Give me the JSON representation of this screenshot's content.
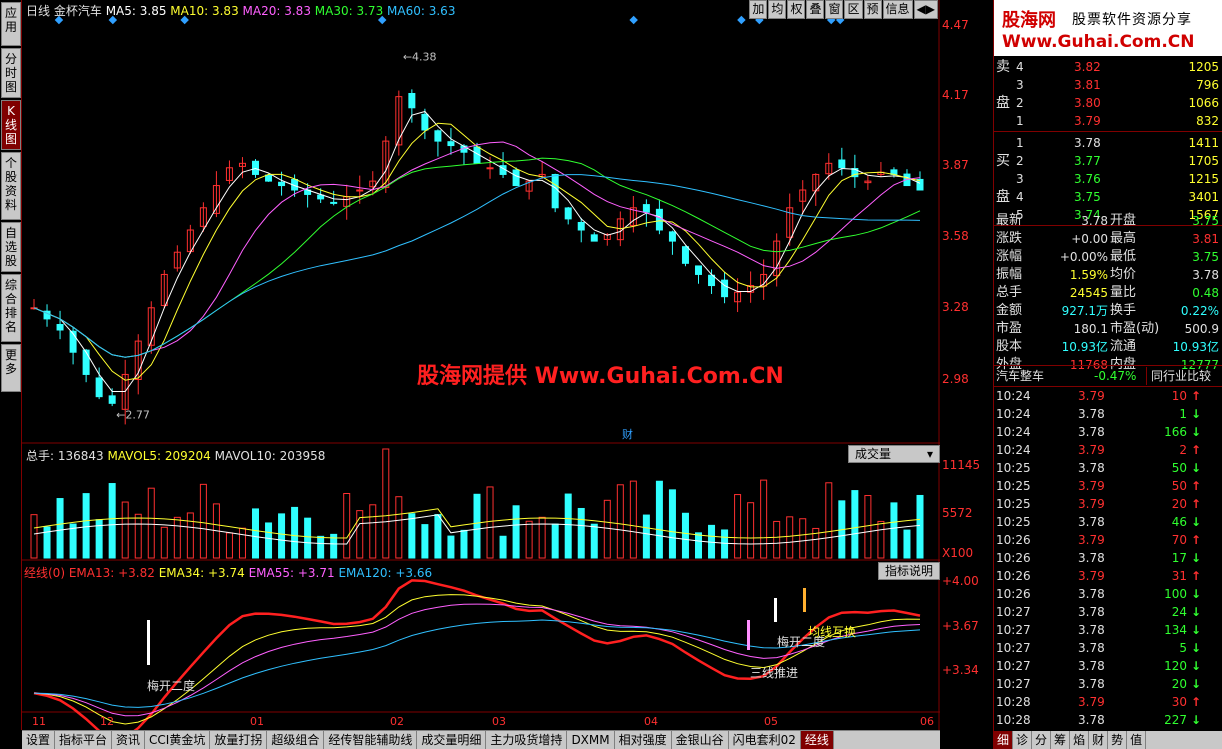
{
  "left_tabs": [
    {
      "label": "应用"
    },
    {
      "label": "分时图"
    },
    {
      "label": "K线图",
      "active": true
    },
    {
      "label": "个股资料"
    },
    {
      "label": "自选股"
    },
    {
      "label": "综合排名"
    },
    {
      "label": "更多"
    }
  ],
  "top_info": {
    "period": "日线",
    "stock_name": "金杯汽车",
    "ma5": "MA5: 3.85",
    "ma10": "MA10: 3.83",
    "ma20": "MA20: 3.83",
    "ma30": "MA30: 3.73",
    "ma60": "MA60: 3.63"
  },
  "top_buttons": [
    "加",
    "均",
    "权",
    "叠",
    "窗",
    "区",
    "预",
    "信息",
    "◀▶"
  ],
  "price_axis": [
    "4.47",
    "4.17",
    "3.87",
    "3.58",
    "3.28",
    "2.98"
  ],
  "price_annotations": {
    "high": "4.38",
    "low": "2.77",
    "cai_marker": "财"
  },
  "watermark": "股海网提供 Www.Guhai.Com.CN",
  "volume_panel": {
    "title": "总手: 136843",
    "mavol5": "MAVOL5: 209204",
    "mavol10": "MAVOL10: 203958",
    "combo": "成交量",
    "axis": [
      "11145",
      "5572",
      "X100"
    ]
  },
  "jingxian_panel": {
    "title": "经线(0)",
    "ema13": "EMA13: +3.82",
    "ema34": "EMA34: +3.74",
    "ema55": "EMA55: +3.71",
    "ema120": "EMA120: +3.66",
    "combo": "指标说明",
    "axis": [
      "+4.00",
      "+3.67",
      "+3.34"
    ],
    "annotations": [
      "梅开二度",
      "梅开二度",
      "三线推进",
      "均线互换"
    ]
  },
  "date_axis": [
    "11",
    "12",
    "01",
    "02",
    "03",
    "04",
    "05",
    "06"
  ],
  "bottom_tabs": [
    "设置",
    "指标平台",
    "资讯",
    "CCI黄金坑",
    "放量打拐",
    "超级组合",
    "经传智能辅助线",
    "成交量明细",
    "主力吸货增持",
    "DXMM",
    "相对强度",
    "金银山谷",
    "闪电套利02",
    "经线"
  ],
  "colors": {
    "up": "#ff3030",
    "down": "#30ffff",
    "ma5": "#ffffff",
    "ma10": "#ffff30",
    "ma20": "#ff60ff",
    "ma30": "#30ff30",
    "ma60": "#30c0ff"
  },
  "logo": {
    "brand": "股海网",
    "slogan": "股票软件资源分享",
    "url": "Www.Guhai.Com.CN"
  },
  "sell_orders": [
    {
      "side": "卖",
      "level": "4",
      "price": "3.82",
      "vol": "1205"
    },
    {
      "side": "",
      "level": "3",
      "price": "3.81",
      "vol": "796"
    },
    {
      "side": "盘",
      "level": "2",
      "price": "3.80",
      "vol": "1066"
    },
    {
      "side": "",
      "level": "1",
      "price": "3.79",
      "vol": "832"
    }
  ],
  "buy_orders": [
    {
      "side": "",
      "level": "1",
      "price": "3.78",
      "vol": "1411"
    },
    {
      "side": "买",
      "level": "2",
      "price": "3.77",
      "vol": "1705"
    },
    {
      "side": "",
      "level": "3",
      "price": "3.76",
      "vol": "1215"
    },
    {
      "side": "盘",
      "level": "4",
      "price": "3.75",
      "vol": "3401"
    },
    {
      "side": "",
      "level": "5",
      "price": "3.74",
      "vol": "1567"
    }
  ],
  "quote": [
    {
      "l1": "最新",
      "v1": "3.78",
      "l2": "开盘",
      "v2": "3.75",
      "c1": "white",
      "c2": "green"
    },
    {
      "l1": "涨跌",
      "v1": "+0.00",
      "l2": "最高",
      "v2": "3.81",
      "c1": "white",
      "c2": "red"
    },
    {
      "l1": "涨幅",
      "v1": "+0.00%",
      "l2": "最低",
      "v2": "3.75",
      "c1": "white",
      "c2": "green"
    },
    {
      "l1": "振幅",
      "v1": "1.59%",
      "l2": "均价",
      "v2": "3.78",
      "c1": "yellow",
      "c2": "white"
    },
    {
      "l1": "总手",
      "v1": "24545",
      "l2": "量比",
      "v2": "0.48",
      "c1": "yellow",
      "c2": "green"
    },
    {
      "l1": "金额",
      "v1": "927.1万",
      "l2": "换手",
      "v2": "0.22%",
      "c1": "cyan",
      "c2": "cyan"
    },
    {
      "l1": "市盈",
      "v1": "180.1",
      "l2": "市盈(动)",
      "v2": "500.9",
      "c1": "white",
      "c2": "white"
    },
    {
      "l1": "股本",
      "v1": "10.93亿",
      "l2": "流通",
      "v2": "10.93亿",
      "c1": "cyan",
      "c2": "cyan"
    },
    {
      "l1": "外盘",
      "v1": "11768",
      "l2": "内盘",
      "v2": "12777",
      "c1": "red",
      "c2": "green"
    }
  ],
  "industry": {
    "name": "汽车整车",
    "change": "-0.47%",
    "button": "同行业比较"
  },
  "ticks": [
    {
      "t": "10:24",
      "p": "3.79",
      "v": "10",
      "d": "up"
    },
    {
      "t": "10:24",
      "p": "3.78",
      "v": "1",
      "d": "down"
    },
    {
      "t": "10:24",
      "p": "3.78",
      "v": "166",
      "d": "down"
    },
    {
      "t": "10:24",
      "p": "3.79",
      "v": "2",
      "d": "up"
    },
    {
      "t": "10:25",
      "p": "3.78",
      "v": "50",
      "d": "down"
    },
    {
      "t": "10:25",
      "p": "3.79",
      "v": "50",
      "d": "up"
    },
    {
      "t": "10:25",
      "p": "3.79",
      "v": "20",
      "d": "up"
    },
    {
      "t": "10:25",
      "p": "3.78",
      "v": "46",
      "d": "down"
    },
    {
      "t": "10:26",
      "p": "3.79",
      "v": "70",
      "d": "up"
    },
    {
      "t": "10:26",
      "p": "3.78",
      "v": "17",
      "d": "down"
    },
    {
      "t": "10:26",
      "p": "3.79",
      "v": "31",
      "d": "up"
    },
    {
      "t": "10:26",
      "p": "3.78",
      "v": "100",
      "d": "down"
    },
    {
      "t": "10:27",
      "p": "3.78",
      "v": "24",
      "d": "down"
    },
    {
      "t": "10:27",
      "p": "3.78",
      "v": "134",
      "d": "down"
    },
    {
      "t": "10:27",
      "p": "3.78",
      "v": "5",
      "d": "down"
    },
    {
      "t": "10:27",
      "p": "3.78",
      "v": "120",
      "d": "down"
    },
    {
      "t": "10:27",
      "p": "3.78",
      "v": "20",
      "d": "down"
    },
    {
      "t": "10:28",
      "p": "3.79",
      "v": "30",
      "d": "up"
    },
    {
      "t": "10:28",
      "p": "3.78",
      "v": "227",
      "d": "down"
    }
  ],
  "panel_tabs": [
    "细",
    "诊",
    "分",
    "筹",
    "焰",
    "财",
    "势",
    "值"
  ],
  "chart_data": {
    "type": "candlestick",
    "title": "金杯汽车 日线",
    "x_labels": [
      "11",
      "12",
      "01",
      "02",
      "03",
      "04",
      "05",
      "06"
    ],
    "ylim": [
      2.7,
      4.5
    ],
    "price_high": 4.38,
    "price_low": 2.77,
    "ma": {
      "MA5": 3.85,
      "MA10": 3.83,
      "MA20": 3.83,
      "MA30": 3.73,
      "MA60": 3.63
    },
    "volume_last": 136843,
    "volume_ylim": [
      0,
      11145
    ],
    "ema": {
      "EMA13": 3.82,
      "EMA34": 3.74,
      "EMA55": 3.71,
      "EMA120": 3.66
    },
    "ema_ylim": [
      3.2,
      4.05
    ],
    "close_series": [
      3.25,
      3.2,
      3.15,
      3.05,
      2.95,
      2.85,
      2.82,
      2.95,
      3.1,
      3.25,
      3.4,
      3.5,
      3.6,
      3.7,
      3.8,
      3.88,
      3.9,
      3.85,
      3.82,
      3.8,
      3.78,
      3.76,
      3.74,
      3.72,
      3.75,
      3.78,
      3.82,
      4.0,
      4.2,
      4.15,
      4.05,
      4.0,
      3.98,
      3.95,
      3.9,
      3.88,
      3.85,
      3.8,
      3.82,
      3.85,
      3.7,
      3.65,
      3.6,
      3.55,
      3.58,
      3.65,
      3.7,
      3.68,
      3.6,
      3.55,
      3.45,
      3.4,
      3.35,
      3.3,
      3.32,
      3.35,
      3.4,
      3.55,
      3.7,
      3.78,
      3.85,
      3.9,
      3.88,
      3.84,
      3.82,
      3.86,
      3.85,
      3.8,
      3.78
    ]
  }
}
